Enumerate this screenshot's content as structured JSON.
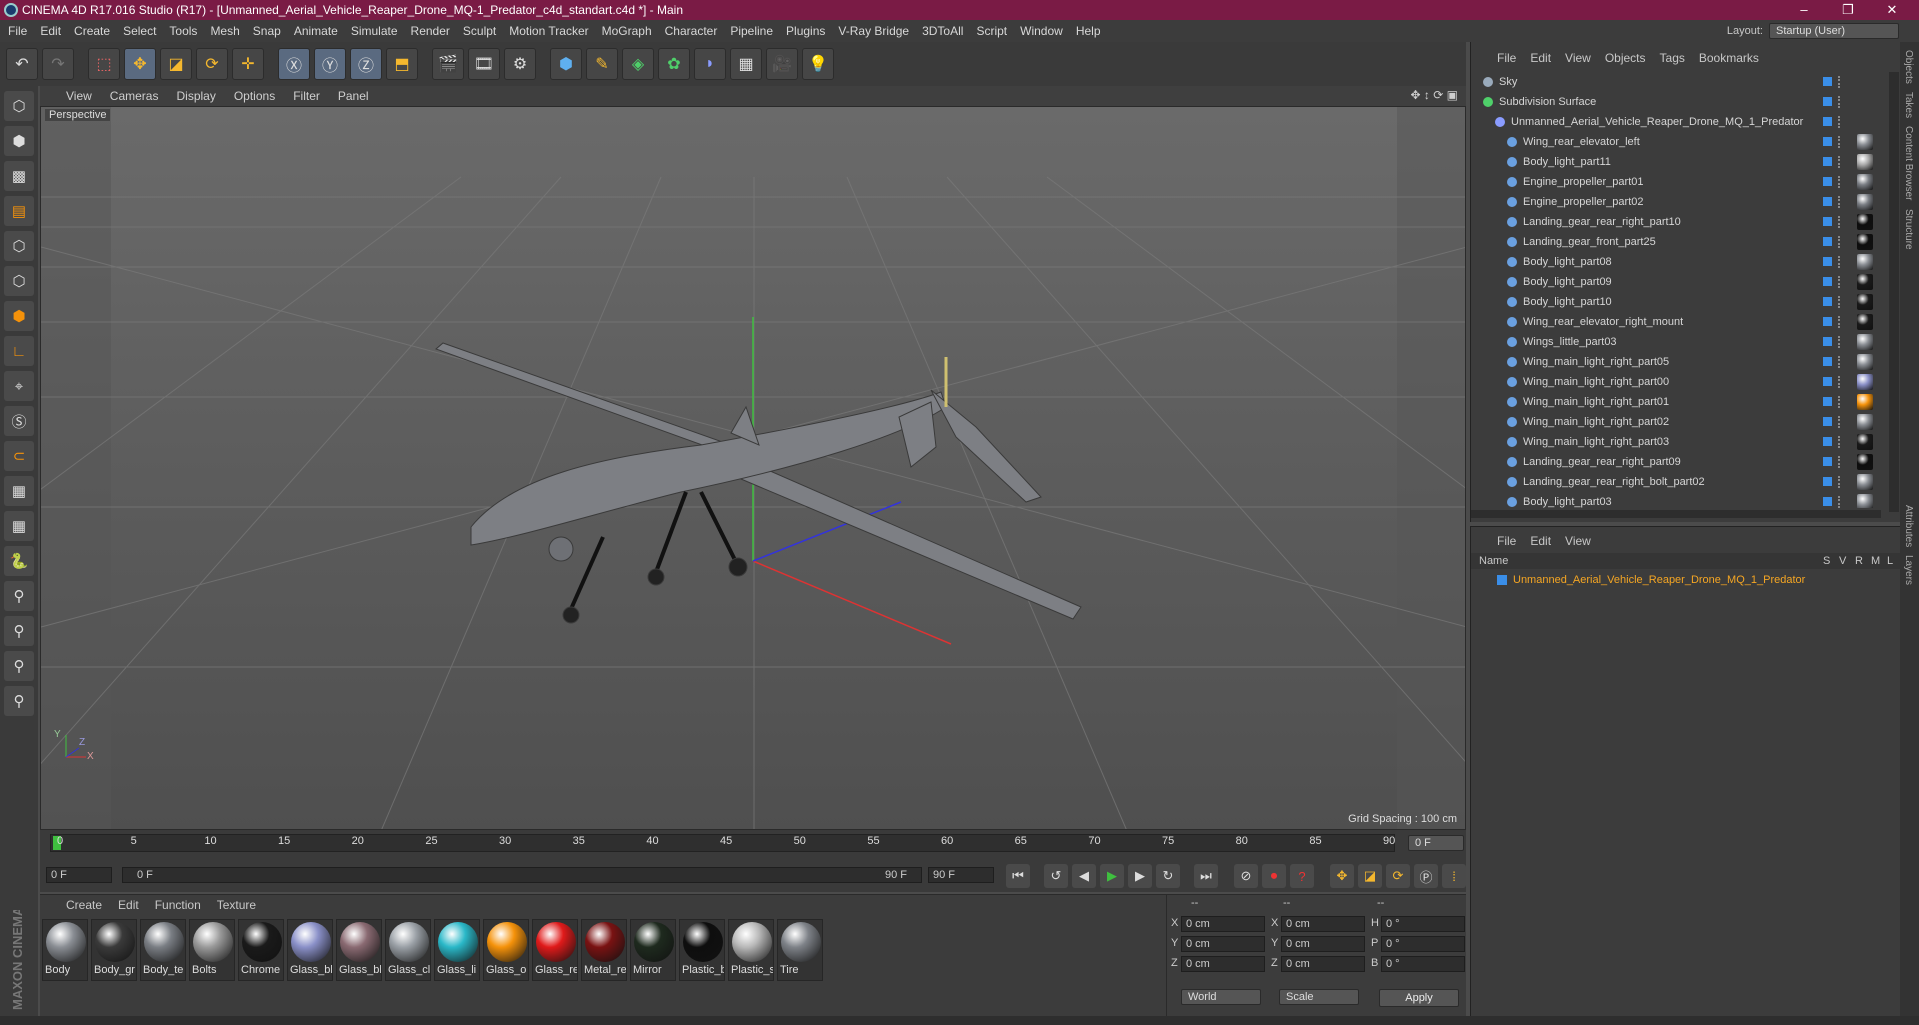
{
  "window": {
    "title": "CINEMA 4D R17.016 Studio (R17) - [Unmanned_Aerial_Vehicle_Reaper_Drone_MQ-1_Predator_c4d_standart.c4d *] - Main",
    "controls": [
      "–",
      "❐",
      "✕"
    ]
  },
  "menu": [
    "File",
    "Edit",
    "Create",
    "Select",
    "Tools",
    "Mesh",
    "Snap",
    "Animate",
    "Simulate",
    "Render",
    "Sculpt",
    "Motion Tracker",
    "MoGraph",
    "Character",
    "Pipeline",
    "Plugins",
    "V-Ray Bridge",
    "3DToAll",
    "Script",
    "Window",
    "Help"
  ],
  "layout": {
    "label": "Layout:",
    "value": "Startup (User)"
  },
  "viewport": {
    "menu": [
      "View",
      "Cameras",
      "Display",
      "Options",
      "Filter",
      "Panel"
    ],
    "label": "Perspective",
    "grid_spacing": "Grid Spacing : 100 cm",
    "axis_x": "X",
    "axis_y": "Y",
    "axis_z": "Z"
  },
  "timeline": {
    "ticks": [
      "0",
      "5",
      "10",
      "15",
      "20",
      "25",
      "30",
      "35",
      "40",
      "45",
      "50",
      "55",
      "60",
      "65",
      "70",
      "75",
      "80",
      "85",
      "90"
    ],
    "current_frame": "0 F",
    "start": "0 F",
    "range_start": "0 F",
    "range_end": "90 F",
    "end": "90 F"
  },
  "materials": {
    "menu": [
      "Create",
      "Edit",
      "Function",
      "Texture"
    ],
    "items": [
      {
        "label": "Body",
        "color": "#8a8e94"
      },
      {
        "label": "Body_gr",
        "color": "#3a3a3a"
      },
      {
        "label": "Body_te",
        "color": "#7a7e84"
      },
      {
        "label": "Bolts",
        "color": "#9a9a9a"
      },
      {
        "label": "Chrome",
        "color": "#1a1a1a"
      },
      {
        "label": "Glass_bl",
        "color": "#8a90c8"
      },
      {
        "label": "Glass_bl",
        "color": "#8a6a72"
      },
      {
        "label": "Glass_cl",
        "color": "#9aa0a6"
      },
      {
        "label": "Glass_li",
        "color": "#2ab8c8"
      },
      {
        "label": "Glass_o",
        "color": "#f5920a"
      },
      {
        "label": "Glass_re",
        "color": "#e01a1a"
      },
      {
        "label": "Metal_re",
        "color": "#7a1212"
      },
      {
        "label": "Mirror",
        "color": "#1e2a1e"
      },
      {
        "label": "Plastic_b",
        "color": "#0e0e0e"
      },
      {
        "label": "Plastic_s",
        "color": "#b8b8b8"
      },
      {
        "label": "Tire",
        "color": "#7e8288"
      }
    ]
  },
  "attributes": {
    "headers": [
      "--",
      "--",
      "--"
    ],
    "rows": [
      {
        "a": "X",
        "av": "0 cm",
        "b": "X",
        "bv": "0 cm",
        "c": "H",
        "cv": "0 °"
      },
      {
        "a": "Y",
        "av": "0 cm",
        "b": "Y",
        "bv": "0 cm",
        "c": "P",
        "cv": "0 °"
      },
      {
        "a": "Z",
        "av": "0 cm",
        "b": "Z",
        "bv": "0 cm",
        "c": "B",
        "cv": "0 °"
      }
    ],
    "coord_system": "World",
    "mode": "Scale",
    "apply": "Apply"
  },
  "objects": {
    "menu": [
      "File",
      "Edit",
      "View",
      "Objects",
      "Tags",
      "Bookmarks"
    ],
    "top": [
      {
        "name": "Sky",
        "indent": 0
      },
      {
        "name": "Subdivision Surface",
        "indent": 0
      },
      {
        "name": "Unmanned_Aerial_Vehicle_Reaper_Drone_MQ_1_Predator",
        "indent": 1
      }
    ],
    "children": [
      {
        "name": "Wing_rear_elevator_left",
        "tag": "#8a8e94"
      },
      {
        "name": "Body_light_part11",
        "tag": "#aaaaaa"
      },
      {
        "name": "Engine_propeller_part01",
        "tag": "#7a7e84"
      },
      {
        "name": "Engine_propeller_part02",
        "tag": "#7a7e84"
      },
      {
        "name": "Landing_gear_rear_right_part10",
        "tag": "#0e0e0e"
      },
      {
        "name": "Landing_gear_front_part25",
        "tag": "#0e0e0e"
      },
      {
        "name": "Body_light_part08",
        "tag": "#8a8e94"
      },
      {
        "name": "Body_light_part09",
        "tag": "#1a1a1a"
      },
      {
        "name": "Body_light_part10",
        "tag": "#1a1a1a"
      },
      {
        "name": "Wing_rear_elevator_right_mount",
        "tag": "#1a1a1a"
      },
      {
        "name": "Wings_little_part03",
        "tag": "#8a8e94"
      },
      {
        "name": "Wing_main_light_right_part05",
        "tag": "#8a8e94"
      },
      {
        "name": "Wing_main_light_right_part00",
        "tag": "#8a90c8"
      },
      {
        "name": "Wing_main_light_right_part01",
        "tag": "#f5920a"
      },
      {
        "name": "Wing_main_light_right_part02",
        "tag": "#8a8e94"
      },
      {
        "name": "Wing_main_light_right_part03",
        "tag": "#1a1a1a"
      },
      {
        "name": "Landing_gear_rear_right_part09",
        "tag": "#0e0e0e"
      },
      {
        "name": "Landing_gear_rear_right_bolt_part02",
        "tag": "#8a8e94"
      },
      {
        "name": "Body_light_part03",
        "tag": "#8a8e94"
      }
    ]
  },
  "layers": {
    "menu": [
      "File",
      "Edit",
      "View"
    ],
    "columns": [
      "Name",
      "S",
      "V",
      "R",
      "M",
      "L"
    ],
    "row": "Unmanned_Aerial_Vehicle_Reaper_Drone_MQ_1_Predator"
  },
  "side_tabs": [
    "Objects",
    "Takes",
    "Content Browser",
    "Structure"
  ],
  "side_tabs2": [
    "Attributes",
    "Layers"
  ],
  "brand": "MAXON CINEMA 4D"
}
